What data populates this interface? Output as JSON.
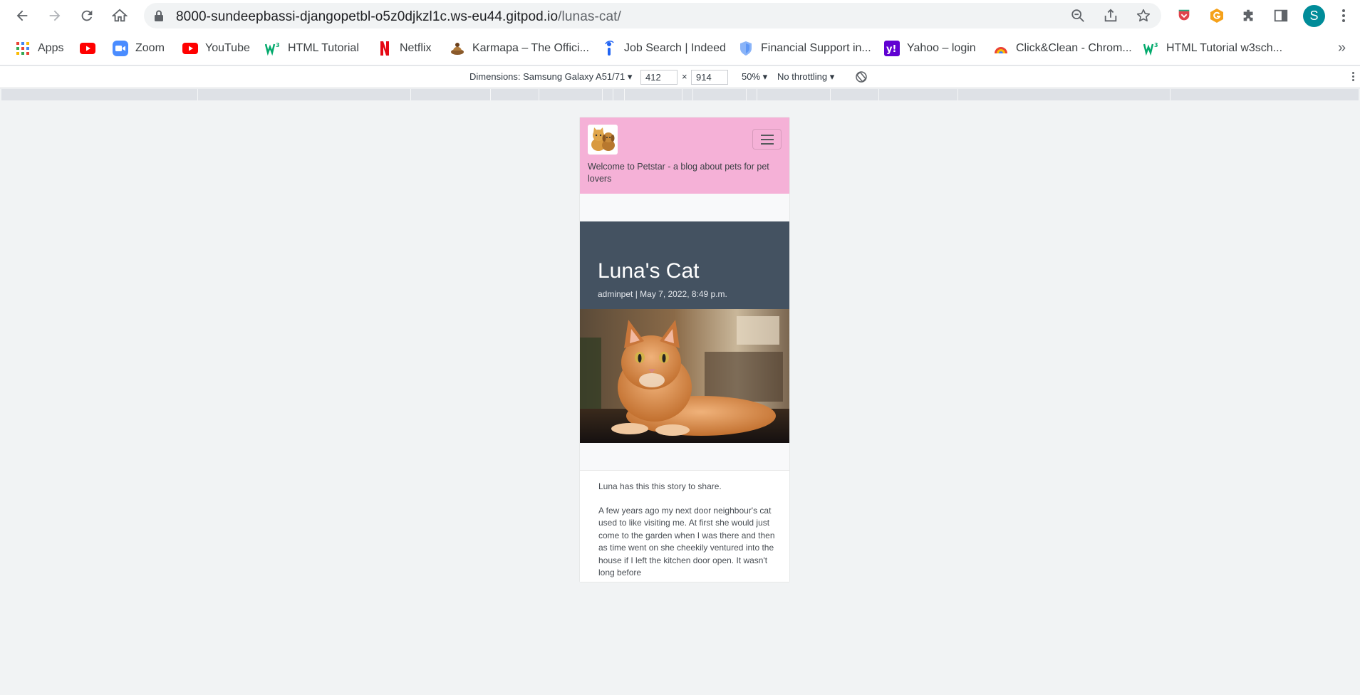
{
  "browser": {
    "url_host": "8000-sundeepbassi-djangopetbl-o5z0djkzl1c.ws-eu44.gitpod.io",
    "url_path": "/lunas-cat/",
    "profile_initial": "S",
    "bookmarks": [
      {
        "label": "Apps",
        "icon": "apps-grid-icon"
      },
      {
        "label": "",
        "icon": "youtube-icon"
      },
      {
        "label": "Zoom",
        "icon": "zoom-icon"
      },
      {
        "label": "YouTube",
        "icon": "youtube-icon"
      },
      {
        "label": "HTML Tutorial",
        "icon": "w3schools-icon"
      },
      {
        "label": "Netflix",
        "icon": "netflix-icon"
      },
      {
        "label": "Karmapa – The Offici...",
        "icon": "karmapa-icon"
      },
      {
        "label": "Job Search | Indeed",
        "icon": "indeed-icon"
      },
      {
        "label": "Financial Support in...",
        "icon": "shield-icon"
      },
      {
        "label": "Yahoo – login",
        "icon": "yahoo-icon"
      },
      {
        "label": "Click&Clean - Chrom...",
        "icon": "clickclean-icon"
      },
      {
        "label": "HTML Tutorial w3sch...",
        "icon": "w3schools-icon"
      }
    ]
  },
  "devtools": {
    "device_label": "Dimensions: Samsung Galaxy A51/71",
    "width": "412",
    "times": "×",
    "height": "914",
    "zoom": "50%",
    "throttling": "No throttling"
  },
  "site": {
    "welcome": "Welcome to Petstar - a blog about pets for pet lovers",
    "post": {
      "title": "Luna's Cat",
      "meta": "adminpet | May 7, 2022, 8:49 p.m.",
      "image_alt": "orange tabby cat lying on a table",
      "paragraphs": [
        "Luna has this this story to share.",
        "A few years ago my next door neighbour's cat used to like visiting me. At first she would just come to the garden when I was there and then as time went on she cheekily ventured into the house if I left the kitchen door open. It wasn't long before"
      ]
    }
  }
}
